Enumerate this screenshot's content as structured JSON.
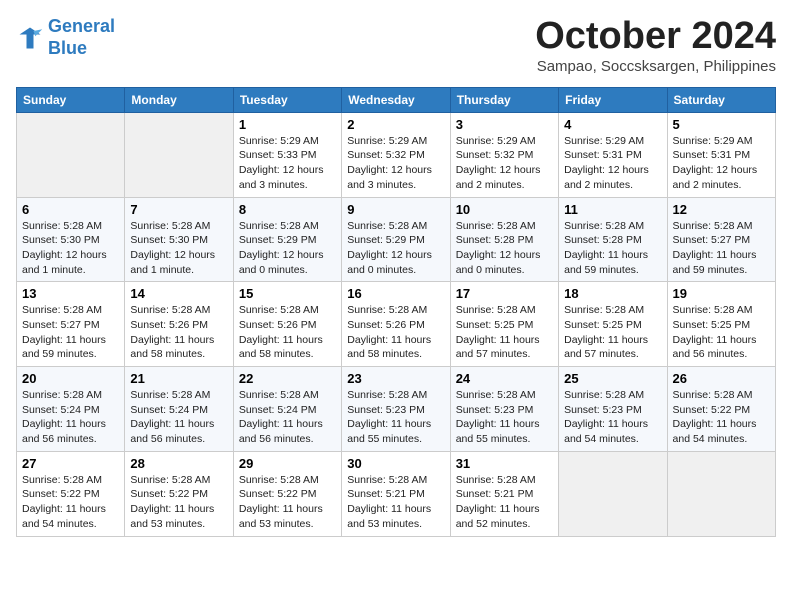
{
  "logo": {
    "line1": "General",
    "line2": "Blue"
  },
  "title": "October 2024",
  "location": "Sampao, Soccsksargen, Philippines",
  "headers": [
    "Sunday",
    "Monday",
    "Tuesday",
    "Wednesday",
    "Thursday",
    "Friday",
    "Saturday"
  ],
  "weeks": [
    [
      {
        "day": "",
        "info": ""
      },
      {
        "day": "",
        "info": ""
      },
      {
        "day": "1",
        "info": "Sunrise: 5:29 AM\nSunset: 5:33 PM\nDaylight: 12 hours and 3 minutes."
      },
      {
        "day": "2",
        "info": "Sunrise: 5:29 AM\nSunset: 5:32 PM\nDaylight: 12 hours and 3 minutes."
      },
      {
        "day": "3",
        "info": "Sunrise: 5:29 AM\nSunset: 5:32 PM\nDaylight: 12 hours and 2 minutes."
      },
      {
        "day": "4",
        "info": "Sunrise: 5:29 AM\nSunset: 5:31 PM\nDaylight: 12 hours and 2 minutes."
      },
      {
        "day": "5",
        "info": "Sunrise: 5:29 AM\nSunset: 5:31 PM\nDaylight: 12 hours and 2 minutes."
      }
    ],
    [
      {
        "day": "6",
        "info": "Sunrise: 5:28 AM\nSunset: 5:30 PM\nDaylight: 12 hours and 1 minute."
      },
      {
        "day": "7",
        "info": "Sunrise: 5:28 AM\nSunset: 5:30 PM\nDaylight: 12 hours and 1 minute."
      },
      {
        "day": "8",
        "info": "Sunrise: 5:28 AM\nSunset: 5:29 PM\nDaylight: 12 hours and 0 minutes."
      },
      {
        "day": "9",
        "info": "Sunrise: 5:28 AM\nSunset: 5:29 PM\nDaylight: 12 hours and 0 minutes."
      },
      {
        "day": "10",
        "info": "Sunrise: 5:28 AM\nSunset: 5:28 PM\nDaylight: 12 hours and 0 minutes."
      },
      {
        "day": "11",
        "info": "Sunrise: 5:28 AM\nSunset: 5:28 PM\nDaylight: 11 hours and 59 minutes."
      },
      {
        "day": "12",
        "info": "Sunrise: 5:28 AM\nSunset: 5:27 PM\nDaylight: 11 hours and 59 minutes."
      }
    ],
    [
      {
        "day": "13",
        "info": "Sunrise: 5:28 AM\nSunset: 5:27 PM\nDaylight: 11 hours and 59 minutes."
      },
      {
        "day": "14",
        "info": "Sunrise: 5:28 AM\nSunset: 5:26 PM\nDaylight: 11 hours and 58 minutes."
      },
      {
        "day": "15",
        "info": "Sunrise: 5:28 AM\nSunset: 5:26 PM\nDaylight: 11 hours and 58 minutes."
      },
      {
        "day": "16",
        "info": "Sunrise: 5:28 AM\nSunset: 5:26 PM\nDaylight: 11 hours and 58 minutes."
      },
      {
        "day": "17",
        "info": "Sunrise: 5:28 AM\nSunset: 5:25 PM\nDaylight: 11 hours and 57 minutes."
      },
      {
        "day": "18",
        "info": "Sunrise: 5:28 AM\nSunset: 5:25 PM\nDaylight: 11 hours and 57 minutes."
      },
      {
        "day": "19",
        "info": "Sunrise: 5:28 AM\nSunset: 5:25 PM\nDaylight: 11 hours and 56 minutes."
      }
    ],
    [
      {
        "day": "20",
        "info": "Sunrise: 5:28 AM\nSunset: 5:24 PM\nDaylight: 11 hours and 56 minutes."
      },
      {
        "day": "21",
        "info": "Sunrise: 5:28 AM\nSunset: 5:24 PM\nDaylight: 11 hours and 56 minutes."
      },
      {
        "day": "22",
        "info": "Sunrise: 5:28 AM\nSunset: 5:24 PM\nDaylight: 11 hours and 56 minutes."
      },
      {
        "day": "23",
        "info": "Sunrise: 5:28 AM\nSunset: 5:23 PM\nDaylight: 11 hours and 55 minutes."
      },
      {
        "day": "24",
        "info": "Sunrise: 5:28 AM\nSunset: 5:23 PM\nDaylight: 11 hours and 55 minutes."
      },
      {
        "day": "25",
        "info": "Sunrise: 5:28 AM\nSunset: 5:23 PM\nDaylight: 11 hours and 54 minutes."
      },
      {
        "day": "26",
        "info": "Sunrise: 5:28 AM\nSunset: 5:22 PM\nDaylight: 11 hours and 54 minutes."
      }
    ],
    [
      {
        "day": "27",
        "info": "Sunrise: 5:28 AM\nSunset: 5:22 PM\nDaylight: 11 hours and 54 minutes."
      },
      {
        "day": "28",
        "info": "Sunrise: 5:28 AM\nSunset: 5:22 PM\nDaylight: 11 hours and 53 minutes."
      },
      {
        "day": "29",
        "info": "Sunrise: 5:28 AM\nSunset: 5:22 PM\nDaylight: 11 hours and 53 minutes."
      },
      {
        "day": "30",
        "info": "Sunrise: 5:28 AM\nSunset: 5:21 PM\nDaylight: 11 hours and 53 minutes."
      },
      {
        "day": "31",
        "info": "Sunrise: 5:28 AM\nSunset: 5:21 PM\nDaylight: 11 hours and 52 minutes."
      },
      {
        "day": "",
        "info": ""
      },
      {
        "day": "",
        "info": ""
      }
    ]
  ]
}
